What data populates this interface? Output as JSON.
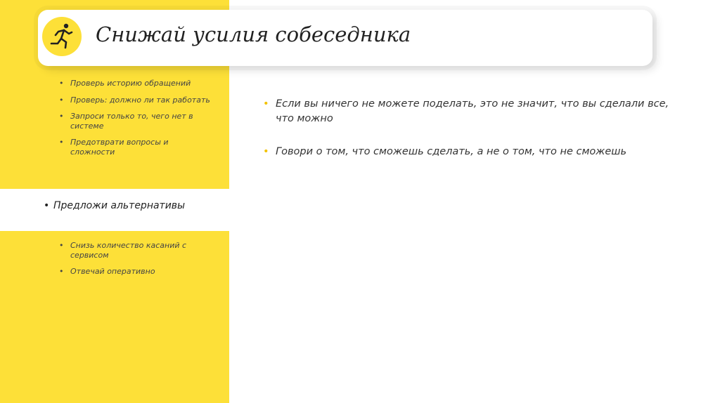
{
  "title": "Снижай усилия собеседника",
  "logo": {
    "icon": "running-person-icon",
    "color": "#fde038"
  },
  "colors": {
    "accent": "#fde038",
    "text": "#333333"
  },
  "left": {
    "top_items": [
      "Проверь историю обращений",
      "Проверь: должно ли так работать",
      "Запроси только то, чего нет в системе",
      "Предотврати вопросы и сложности"
    ],
    "highlight_item": "Предложи альтернативы",
    "bottom_items": [
      "Снизь количество касаний с сервисом",
      "Отвечай оперативно"
    ]
  },
  "right": {
    "items": [
      "Если вы ничего не можете поделать, это не значит, что вы сделали все, что можно",
      "Говори о том, что сможешь сделать, а не о том, что не сможешь"
    ]
  }
}
